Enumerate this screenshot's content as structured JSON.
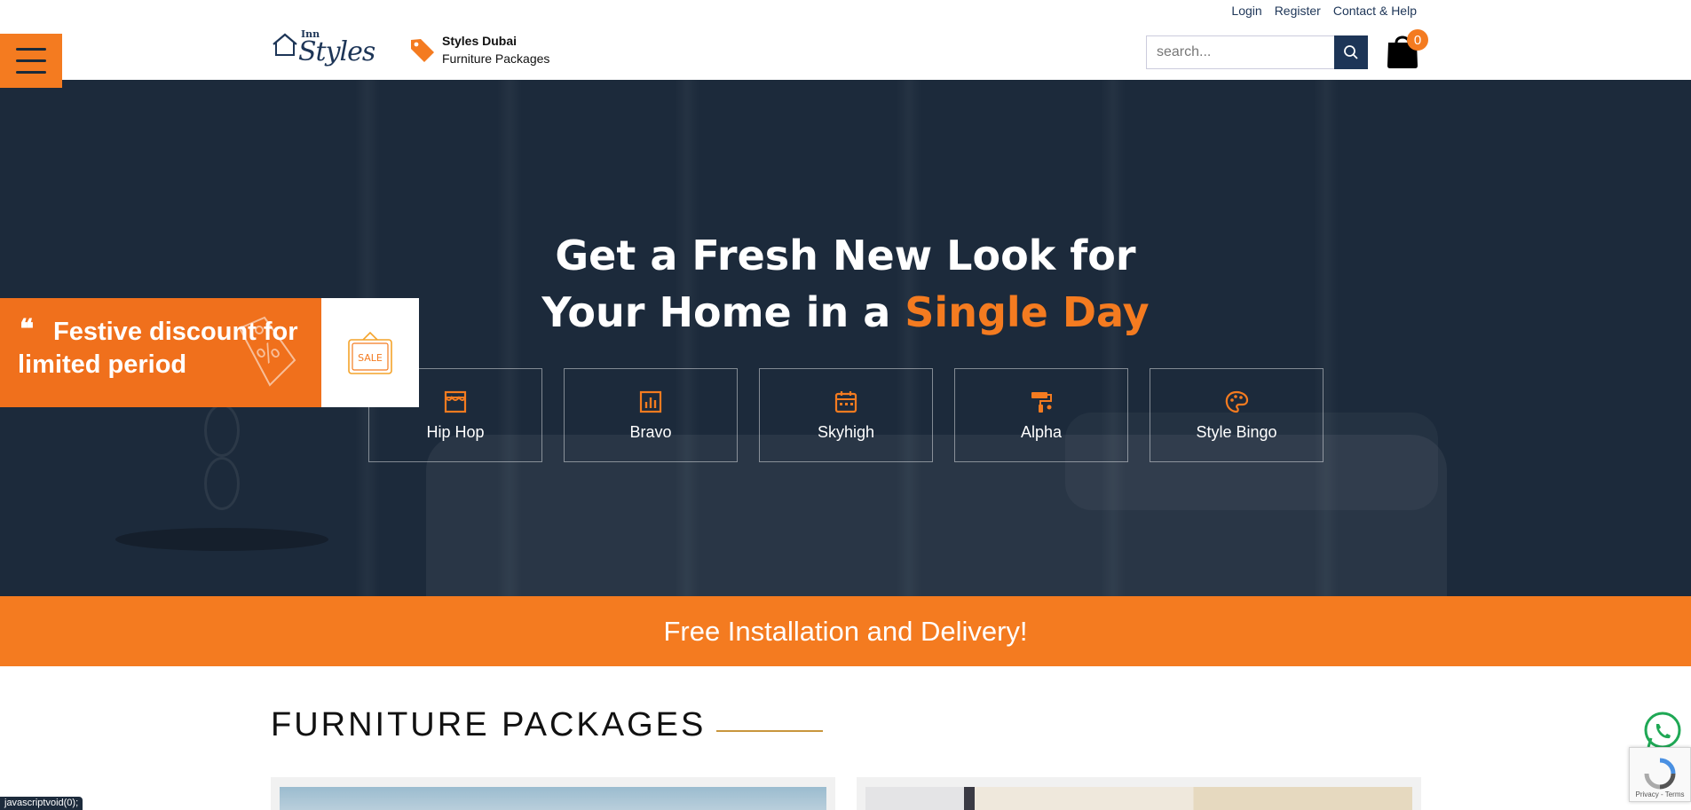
{
  "header": {
    "logo_small": "Inn",
    "logo_main": "Styles",
    "promo_title": "Styles Dubai",
    "promo_subtitle": "Furniture Packages",
    "top_links": [
      "Login",
      "Register",
      "Contact & Help"
    ],
    "search_placeholder": "search...",
    "cart_count": "0"
  },
  "hero": {
    "headline_line1": "Get a Fresh New Look for",
    "headline_line2_prefix": "Your Home in a ",
    "headline_line2_highlight": "Single Day",
    "packages": [
      {
        "label": "Hip Hop",
        "icon": "store-icon"
      },
      {
        "label": "Bravo",
        "icon": "bar-chart-icon"
      },
      {
        "label": "Skyhigh",
        "icon": "calendar-icon"
      },
      {
        "label": "Alpha",
        "icon": "paint-roller-icon"
      },
      {
        "label": "Style Bingo",
        "icon": "palette-icon"
      }
    ],
    "discount_line1": "Festive discount for",
    "discount_line2": "limited period",
    "sale_sign": "SALE"
  },
  "banner": {
    "text": "Free Installation and Delivery!"
  },
  "section": {
    "title": "FURNITURE PACKAGES"
  },
  "recaptcha": {
    "terms": "Privacy - Terms"
  },
  "statusbar": {
    "text": "javascriptvoid(0);"
  },
  "colors": {
    "accent": "#f47b20",
    "navy": "#1d3557",
    "hero_bg": "#1c2a3b"
  }
}
